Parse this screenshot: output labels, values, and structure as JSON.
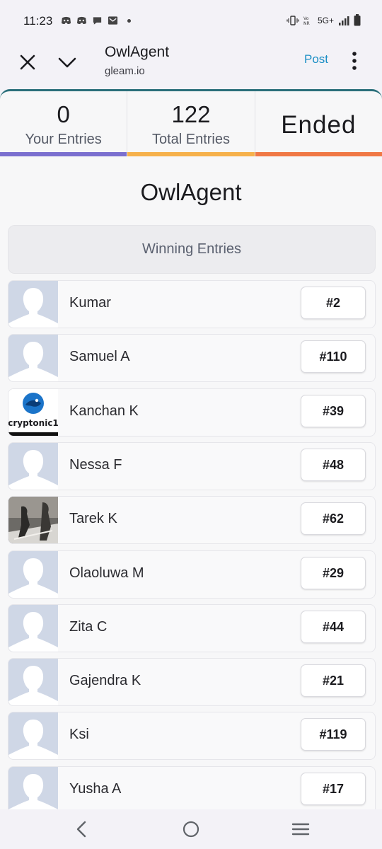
{
  "status_bar": {
    "time": "11:23",
    "network": "5G+",
    "left_icons": [
      "discord-icon",
      "discord-icon",
      "chat-bubble-icon",
      "mail-icon"
    ],
    "right_icons": [
      "vibrate-icon",
      "volte-icon",
      "signal-icon",
      "battery-icon"
    ]
  },
  "app_bar": {
    "title": "OwlAgent",
    "domain": "gleam.io",
    "post_label": "Post",
    "accent": "#1a8ec5"
  },
  "stats": [
    {
      "value": "0",
      "label": "Your Entries",
      "bar_color": "#7b6fcf"
    },
    {
      "value": "122",
      "label": "Total Entries",
      "bar_color": "#f6b14b"
    },
    {
      "value": "Ended",
      "label": "",
      "bar_color": "#f07845"
    }
  ],
  "competition": {
    "title": "OwlAgent",
    "winners_header": "Winning Entries"
  },
  "winners": [
    {
      "name": "Kumar",
      "entry": "#2",
      "avatar": "default-avatar"
    },
    {
      "name": "Samuel A",
      "entry": "#110",
      "avatar": "default-avatar"
    },
    {
      "name": "Kanchan K",
      "entry": "#39",
      "avatar": "cryptonic-logo",
      "avatar_text": "cryptonic1"
    },
    {
      "name": "Nessa F",
      "entry": "#48",
      "avatar": "default-avatar"
    },
    {
      "name": "Tarek K",
      "entry": "#62",
      "avatar": "photo-avatar"
    },
    {
      "name": "Olaoluwa M",
      "entry": "#29",
      "avatar": "default-avatar"
    },
    {
      "name": "Zita C",
      "entry": "#44",
      "avatar": "default-avatar"
    },
    {
      "name": "Gajendra K",
      "entry": "#21",
      "avatar": "default-avatar"
    },
    {
      "name": "Ksi",
      "entry": "#119",
      "avatar": "default-avatar"
    },
    {
      "name": "Yusha A",
      "entry": "#17",
      "avatar": "default-avatar"
    }
  ],
  "nav_bar": {
    "icons": [
      "back-icon",
      "home-icon",
      "recents-icon"
    ]
  }
}
